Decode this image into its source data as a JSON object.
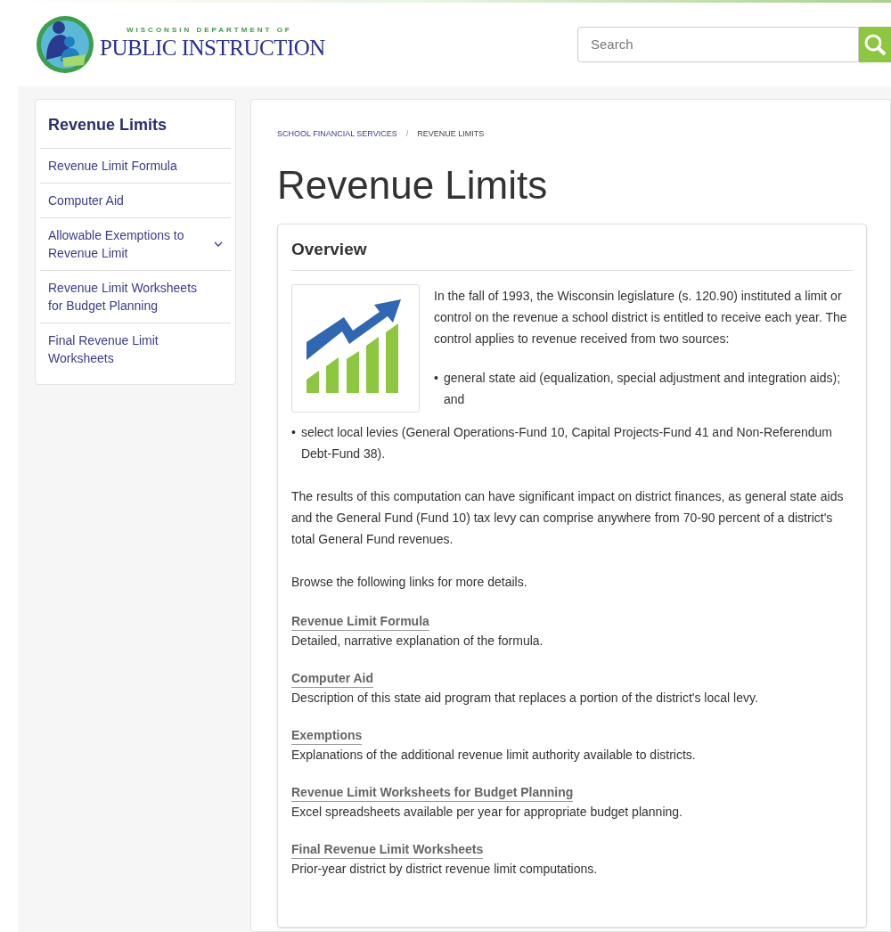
{
  "header": {
    "logo_small": "WISCONSIN DEPARTMENT OF",
    "logo_large": "PUBLIC INSTRUCTION",
    "search": {
      "placeholder": "Search"
    }
  },
  "sidebar": {
    "title": "Revenue Limits",
    "items": [
      {
        "label": "Revenue Limit Formula",
        "expandable": false
      },
      {
        "label": "Computer Aid",
        "expandable": false
      },
      {
        "label": "Allowable Exemptions to Revenue Limit",
        "expandable": true
      },
      {
        "label": "Revenue Limit Worksheets for Budget Planning",
        "expandable": false
      },
      {
        "label": "Final Revenue Limit Worksheets",
        "expandable": false
      }
    ]
  },
  "breadcrumb": [
    {
      "label": "SCHOOL FINANCIAL SERVICES"
    },
    {
      "label": "/"
    },
    {
      "label": "REVENUE LIMITS"
    }
  ],
  "title": "Revenue Limits",
  "overview": {
    "heading": "Overview",
    "intro": "In the fall of 1993, the Wisconsin legislature (s. 120.90) instituted a limit or control on the revenue a school district is entitled to receive each year. The control applies to revenue received from two sources:",
    "bullets": [
      {
        "mark": "•",
        "text": "general state aid (equalization, special adjustment and integration aids); and"
      },
      {
        "mark": "•",
        "text": "select local levies (General Operations-Fund 10, Capital Projects-Fund 41 and Non-Referendum Debt-Fund 38)."
      }
    ],
    "paragraphs": [
      "The results of this computation can have significant impact on district finances, as general state aids and the General Fund (Fund 10) tax levy can comprise anywhere from 70-90 percent of a district's total General Fund revenues.",
      "Browse the following links for more details."
    ],
    "links": [
      {
        "label": "Revenue Limit Formula",
        "description": "Detailed, narrative explanation of the formula."
      },
      {
        "label": "Computer Aid",
        "description": "Description of this state aid program that replaces a portion of the district's local levy."
      },
      {
        "label": "Exemptions",
        "description": "Explanations of the additional revenue limit authority available to districts."
      },
      {
        "label": "Revenue Limit Worksheets for Budget Planning",
        "description": "Excel spreadsheets available per year for appropriate budget planning."
      },
      {
        "label": "Final Revenue Limit Worksheets",
        "description": "Prior-year district by district revenue limit computations."
      }
    ]
  }
}
